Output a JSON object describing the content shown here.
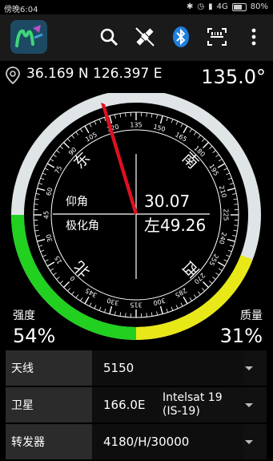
{
  "status": {
    "time": "傍晚6:04",
    "network": "4G",
    "battery": "80%"
  },
  "toolbar": {
    "app_icon": "m-satellite-logo",
    "icons": [
      "search-icon",
      "satellite-icon",
      "bluetooth-icon",
      "barcode-scan-icon",
      "more-vert-icon"
    ]
  },
  "location": {
    "coords": "36.169 N 126.397 E",
    "azimuth": "135.0°"
  },
  "compass": {
    "directions": {
      "east": "东",
      "south": "南",
      "north": "北",
      "west": "西"
    },
    "elevation_label": "仰角",
    "elevation_value": "30.07",
    "polarization_label": "极化角",
    "polarization_value": "左49.26",
    "scale_labels": [
      "105",
      "120",
      "135",
      "150",
      "165",
      "180",
      "195",
      "210",
      "225",
      "240",
      "255",
      "270",
      "285",
      "300",
      "315",
      "330",
      "345",
      "0",
      "15",
      "30",
      "45",
      "60",
      "75",
      "90"
    ],
    "needle_color": "#e01020",
    "strength_arc_color": "#22d020",
    "quality_arc_color": "#e8e818"
  },
  "signal": {
    "strength_label": "强度",
    "strength_value": "54%",
    "quality_label": "质量",
    "quality_value": "31%"
  },
  "rows": [
    {
      "label": "天线",
      "value": "5150",
      "extra": ""
    },
    {
      "label": "卫星",
      "value": "166.0E",
      "extra_line1": "Intelsat 19",
      "extra_line2": "(IS-19)"
    },
    {
      "label": "转发器",
      "value": "4180/H/30000"
    }
  ]
}
